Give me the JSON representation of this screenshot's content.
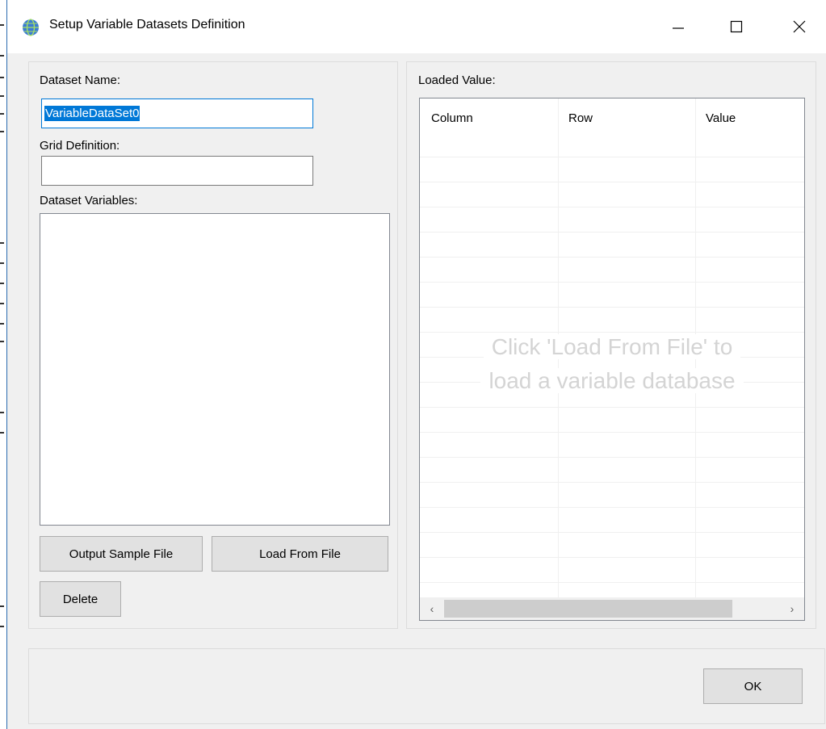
{
  "window": {
    "title": "Setup Variable Datasets Definition",
    "controls": {
      "minimize": "minimize",
      "maximize": "maximize",
      "close": "close"
    }
  },
  "left_panel": {
    "dataset_name_label": "Dataset Name:",
    "dataset_name_value": "VariableDataSet0",
    "grid_definition_label": "Grid Definition:",
    "grid_definition_value": "",
    "dataset_variables_label": "Dataset Variables:",
    "output_sample_button": "Output Sample File",
    "load_from_file_button": "Load From File",
    "delete_button": "Delete"
  },
  "right_panel": {
    "loaded_value_label": "Loaded Value:",
    "columns": [
      "Column",
      "Row",
      "Value"
    ],
    "empty_message_line1": "Click 'Load From File' to",
    "empty_message_line2": "load a variable database"
  },
  "footer": {
    "ok_button": "OK"
  },
  "colors": {
    "selection": "#0078d7",
    "focus_border": "#0078d7",
    "window_bg": "#f0f0f0"
  },
  "icons": [
    "globe-icon",
    "minimize-icon",
    "maximize-icon",
    "close-icon",
    "scroll-left-icon",
    "scroll-right-icon"
  ]
}
